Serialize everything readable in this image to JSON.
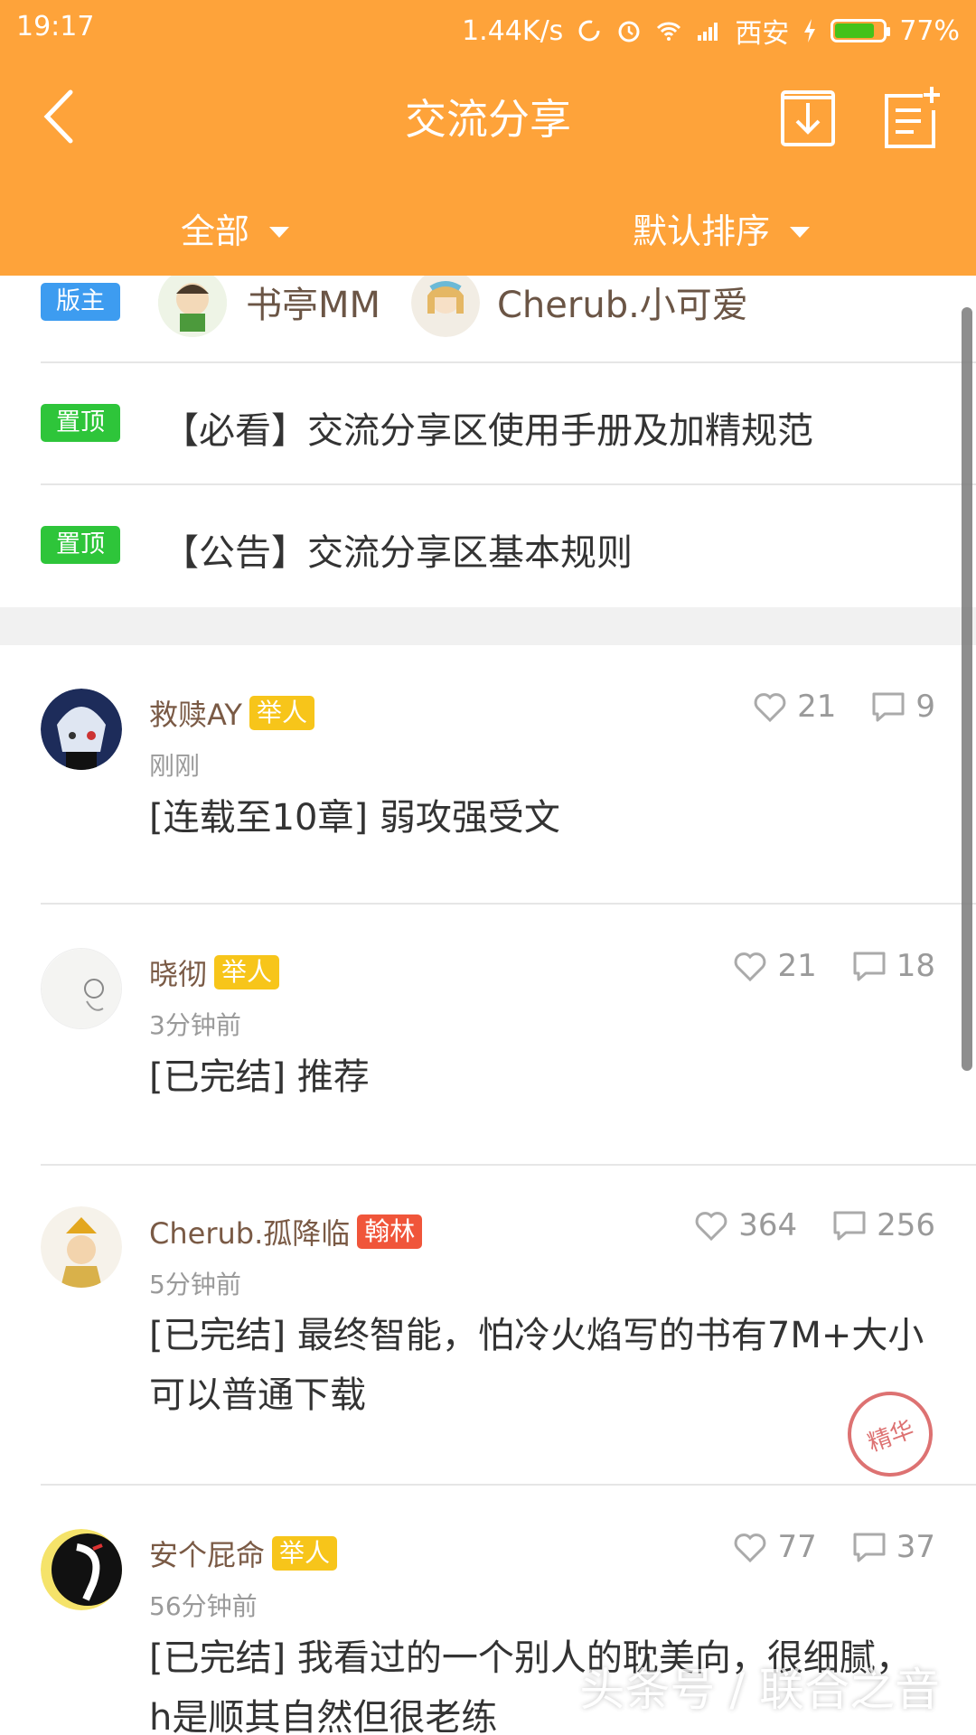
{
  "status_bar": {
    "time": "19:17",
    "speed": "1.44K/s",
    "carrier": "西安",
    "battery": "77%"
  },
  "title_bar": {
    "title": "交流分享"
  },
  "filters": {
    "left": "全部",
    "right": "默认排序"
  },
  "moderators": {
    "tag": "版主",
    "users": [
      "书亭MM",
      "Cherub.小可爱"
    ]
  },
  "pinned": [
    {
      "tag": "置顶",
      "title": "【必看】交流分享区使用手册及加精规范"
    },
    {
      "tag": "置顶",
      "title": "【公告】交流分享区基本规则"
    }
  ],
  "posts": [
    {
      "author": "救赎AY",
      "badge": "举人",
      "time": "刚刚",
      "title": "[连载至10章]  弱攻强受文",
      "likes": "21",
      "comments": "9"
    },
    {
      "author": "晓彻",
      "badge": "举人",
      "time": "3分钟前",
      "title": "[已完结]  推荐",
      "likes": "21",
      "comments": "18"
    },
    {
      "author": "Cherub.孤降临",
      "badge": "翰林",
      "time": "5分钟前",
      "title": "[已完结]  最终智能，怕冷火焰写的书有7M+大小可以普通下载",
      "likes": "364",
      "comments": "256",
      "seal": "精华"
    },
    {
      "author": "安个屁命",
      "badge": "举人",
      "time": "56分钟前",
      "title": "[已完结]  我看过的一个别人的耽美向，很细腻，h是顺其自然但很老练",
      "likes": "77",
      "comments": "37"
    }
  ],
  "watermark": "头条号 / 联合之音",
  "colors": {
    "header": "#fea33a",
    "tag_blue": "#3d9cf0",
    "tag_green": "#2ec53a",
    "badge_yellow": "#f7c51a",
    "badge_red": "#f0553a"
  }
}
